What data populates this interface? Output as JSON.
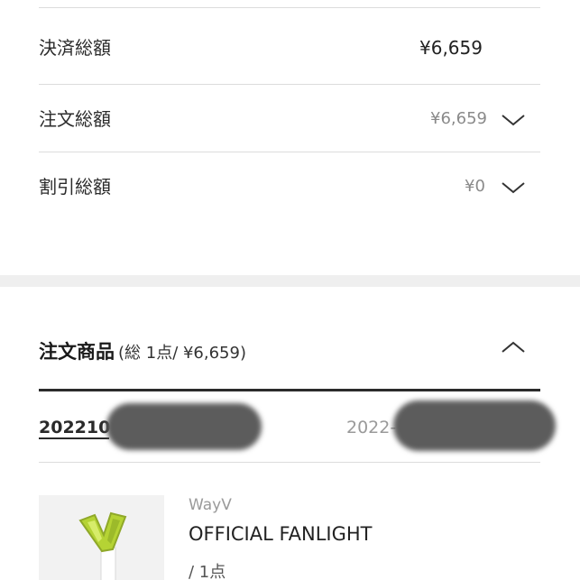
{
  "summary": {
    "rows": [
      {
        "label": "決済総額",
        "amount": "¥6,659",
        "has_chevron": false
      },
      {
        "label": "注文総額",
        "amount": "¥6,659",
        "has_chevron": true
      },
      {
        "label": "割引総額",
        "amount": "¥0",
        "has_chevron": true
      }
    ]
  },
  "ordered_items": {
    "title": "注文商品",
    "subtitle": "(総 1点/ ¥6,659)",
    "order_tabs": [
      {
        "label": "202210",
        "active": true
      },
      {
        "label": "2022-",
        "active": false
      }
    ],
    "product": {
      "brand": "WayV",
      "name": "OFFICIAL FANLIGHT",
      "quantity": "/ 1点"
    }
  },
  "icons": {
    "row_expand": "chevron-down-icon",
    "section_collapse": "chevron-up-icon"
  },
  "colors": {
    "divider": "#dcdcdc",
    "section_gap": "#efefef",
    "muted_text": "#8a8a8a",
    "dark_rule": "#2b2b2b",
    "lightstick_green": "#b5d334"
  }
}
